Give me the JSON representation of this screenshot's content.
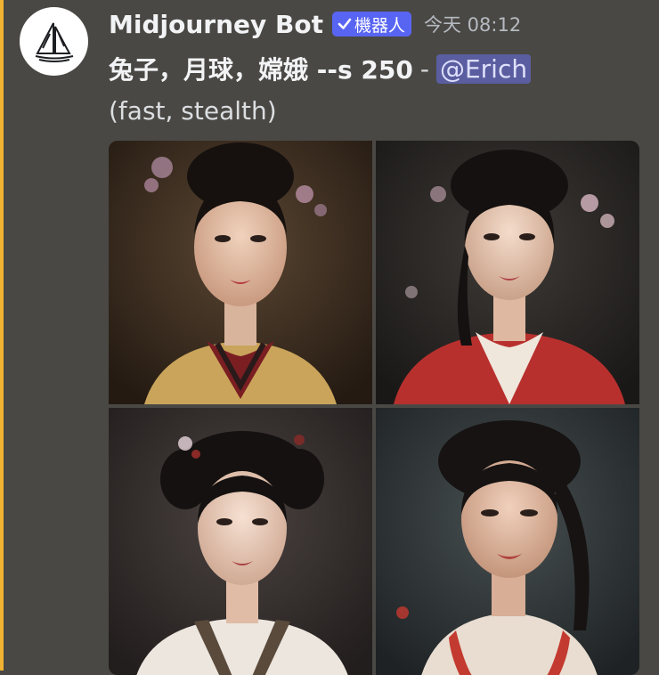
{
  "author": {
    "name": "Midjourney Bot",
    "bot_tag": "機器人",
    "timestamp": "今天 08:12",
    "avatar_icon": "sailboat-icon"
  },
  "message": {
    "prompt": "兔子，月球，嫦娥 --s 250",
    "separator": "-",
    "mention": "@Erich",
    "mode": "(fast, stealth)"
  },
  "attachment": {
    "type": "image-grid",
    "tiles": [
      {
        "name": "portrait-1",
        "bg": "#3a2e22",
        "robe": "#c9a45a",
        "accent": "#7a1e22"
      },
      {
        "name": "portrait-2",
        "bg": "#2a2725",
        "robe": "#b8302e",
        "accent": "#efe6dc"
      },
      {
        "name": "portrait-3",
        "bg": "#3b3533",
        "robe": "#ece6de",
        "accent": "#8a2a26"
      },
      {
        "name": "portrait-4",
        "bg": "#33383a",
        "robe": "#e8ddd0",
        "accent": "#c33a30"
      }
    ]
  },
  "colors": {
    "background": "#4a4844",
    "highlight": "#f0b232",
    "bot_tag": "#5865f2",
    "mention_bg": "#5a5ea0"
  }
}
